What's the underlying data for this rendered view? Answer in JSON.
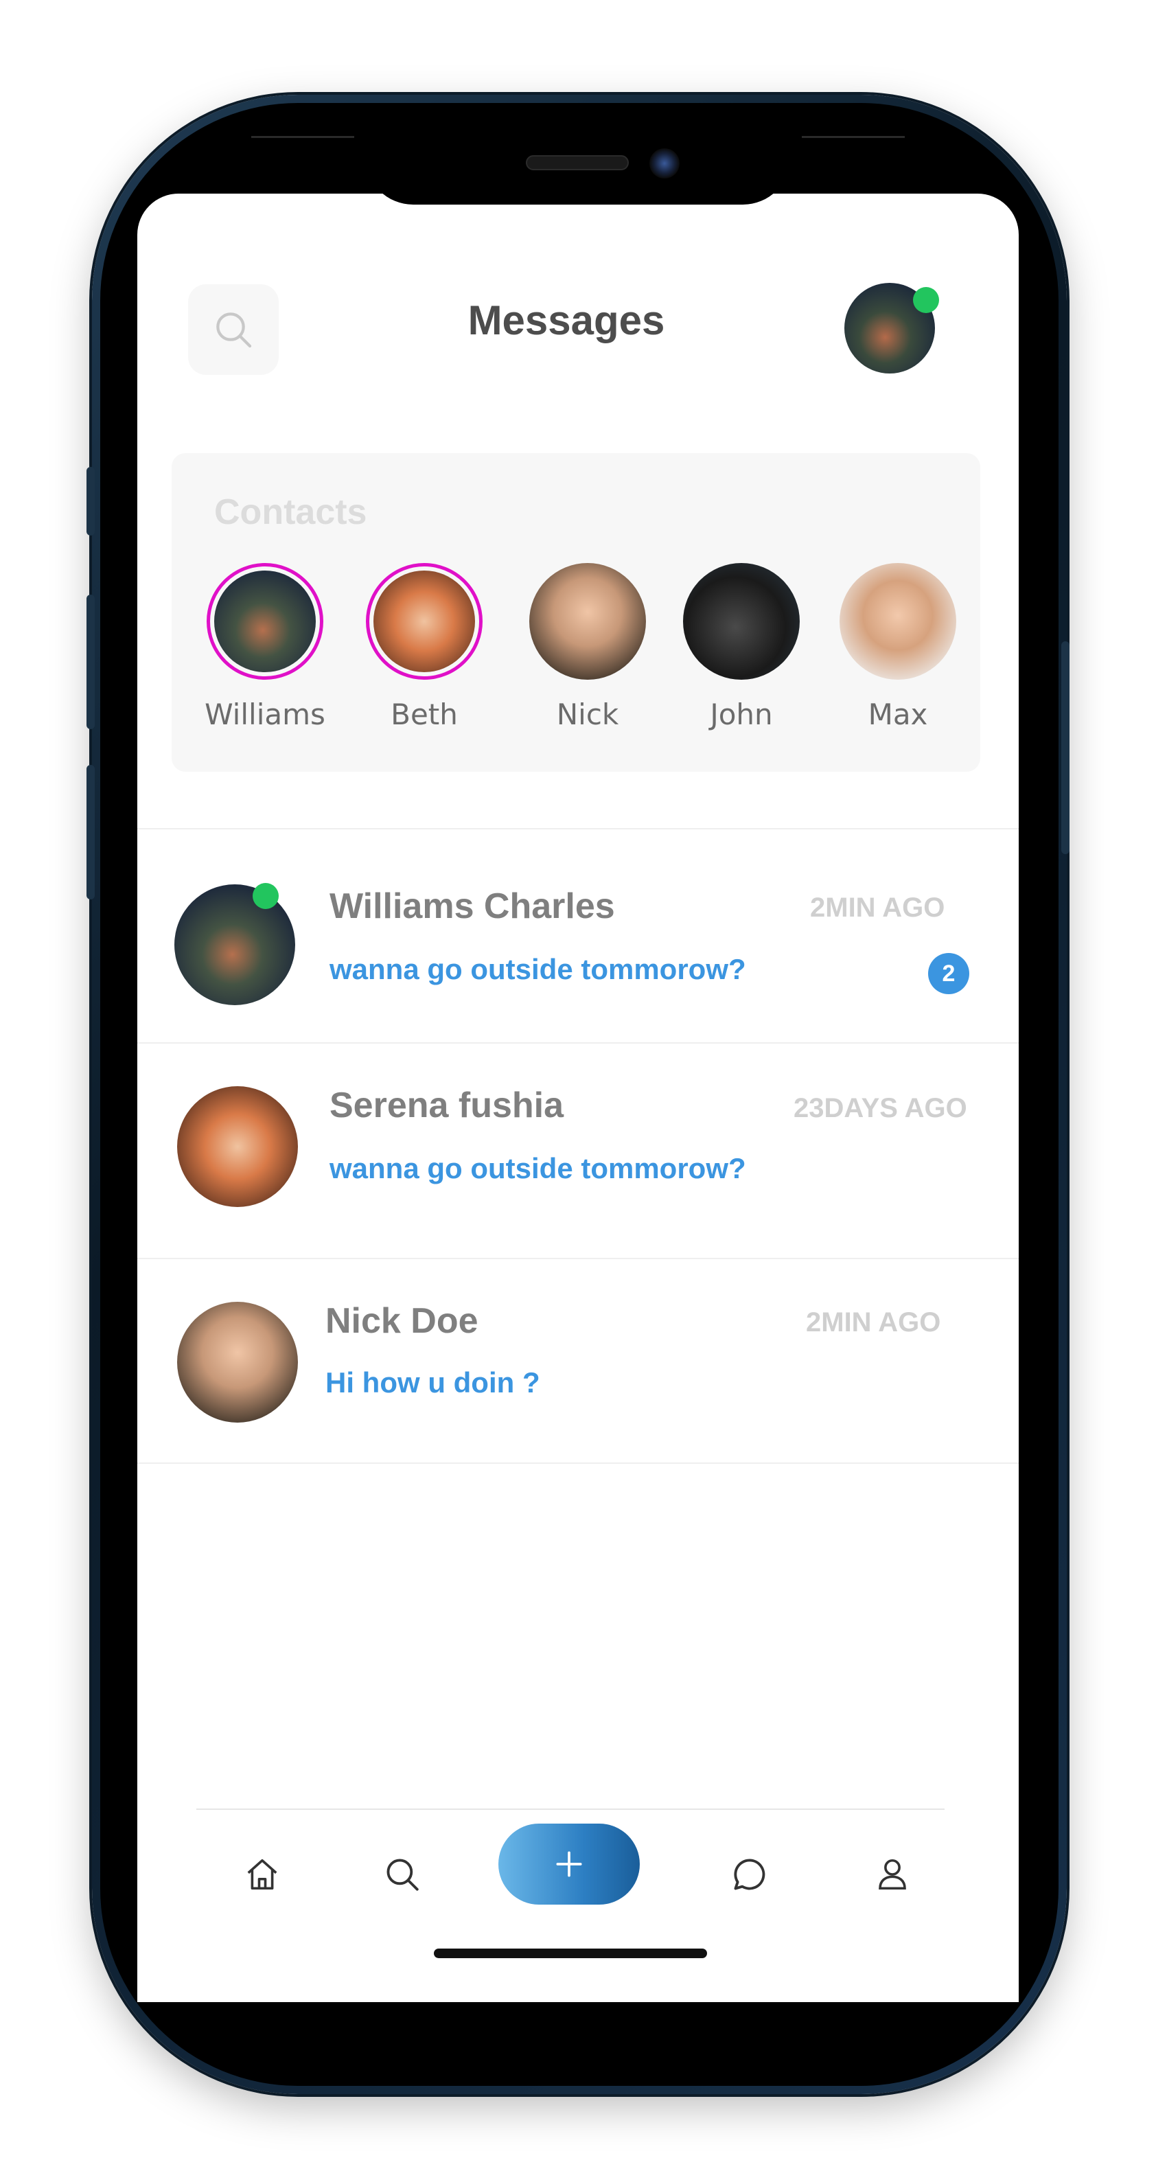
{
  "header": {
    "title": "Messages",
    "search_icon": "search-icon",
    "user_online": true
  },
  "contacts": {
    "title": "Contacts",
    "items": [
      {
        "name": "Williams",
        "has_story": true
      },
      {
        "name": "Beth",
        "has_story": true
      },
      {
        "name": "Nick",
        "has_story": false
      },
      {
        "name": "John",
        "has_story": false
      },
      {
        "name": "Max",
        "has_story": false
      }
    ]
  },
  "messages": [
    {
      "name": "Williams Charles",
      "time": "2MIN AGO",
      "text": "wanna go outside tommorow?",
      "unread": "2",
      "online": true
    },
    {
      "name": "Serena fushia",
      "time": "23DAYS AGO",
      "text": "wanna go outside tommorow?",
      "unread": "",
      "online": false
    },
    {
      "name": "Nick Doe",
      "time": "2MIN AGO",
      "text": "Hi how u doin ?",
      "unread": "",
      "online": false
    }
  ],
  "nav": {
    "items": [
      "home-icon",
      "search-icon",
      "plus-icon",
      "chat-icon",
      "profile-icon"
    ]
  },
  "colors": {
    "accent": "#3b95e0",
    "online": "#22c55e",
    "story_ring": "#e010c8"
  }
}
